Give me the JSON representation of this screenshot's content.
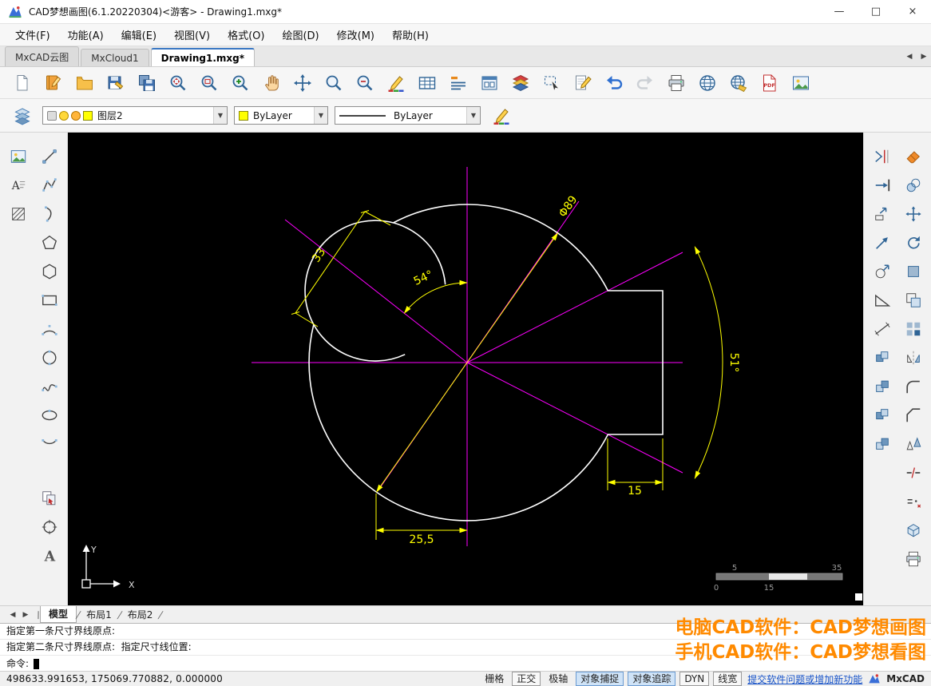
{
  "window": {
    "title": "CAD梦想画图(6.1.20220304)<游客> - Drawing1.mxg*",
    "controls": {
      "minimize": "—",
      "maximize": "□",
      "close": "×"
    }
  },
  "nav": {
    "prev": "◀",
    "next": "▶"
  },
  "menu": {
    "items": [
      {
        "id": "file",
        "label": "文件(F)"
      },
      {
        "id": "function",
        "label": "功能(A)"
      },
      {
        "id": "edit",
        "label": "编辑(E)"
      },
      {
        "id": "view",
        "label": "视图(V)"
      },
      {
        "id": "format",
        "label": "格式(O)"
      },
      {
        "id": "draw",
        "label": "绘图(D)"
      },
      {
        "id": "modify",
        "label": "修改(M)"
      },
      {
        "id": "help",
        "label": "帮助(H)"
      }
    ]
  },
  "doc_tabs": {
    "tabs": [
      {
        "id": "cloud",
        "label": "MxCAD云图",
        "active": false
      },
      {
        "id": "mxcloud1",
        "label": "MxCloud1",
        "active": false
      },
      {
        "id": "drawing1",
        "label": "Drawing1.mxg*",
        "active": true
      }
    ]
  },
  "toolbar": {
    "buttons": [
      {
        "name": "new-file",
        "icon": "page"
      },
      {
        "name": "open-cloud-drawing",
        "icon": "notebook"
      },
      {
        "name": "open-file",
        "icon": "folder"
      },
      {
        "name": "save-file",
        "icon": "floppy"
      },
      {
        "name": "save-all",
        "icon": "floppies"
      },
      {
        "name": "zoom-previous",
        "icon": "magArrows"
      },
      {
        "name": "zoom-window",
        "icon": "magWin"
      },
      {
        "name": "zoom-in",
        "icon": "magPlus"
      },
      {
        "name": "pan",
        "icon": "hand"
      },
      {
        "name": "zoom-extents",
        "icon": "arrowsCross"
      },
      {
        "name": "zoom-scale",
        "icon": "magPlain"
      },
      {
        "name": "zoom-out",
        "icon": "magMinus"
      },
      {
        "name": "draw-color",
        "icon": "pencilColor"
      },
      {
        "name": "insert-table",
        "icon": "table"
      },
      {
        "name": "text-style",
        "icon": "textLines"
      },
      {
        "name": "viewport",
        "icon": "window"
      },
      {
        "name": "layer-properties",
        "icon": "layersColor"
      },
      {
        "name": "select-objects",
        "icon": "selectBox"
      },
      {
        "name": "edit-text",
        "icon": "editPencil"
      },
      {
        "name": "undo",
        "icon": "undo"
      },
      {
        "name": "redo",
        "icon": "redo",
        "disabled": true
      },
      {
        "name": "print",
        "icon": "printer"
      },
      {
        "name": "web-open",
        "icon": "globe"
      },
      {
        "name": "web-upload",
        "icon": "globe2"
      },
      {
        "name": "export-pdf",
        "icon": "pdf"
      },
      {
        "name": "export-image",
        "icon": "image"
      }
    ]
  },
  "layer_bar": {
    "layer_combo": {
      "value": "图层2"
    },
    "color_combo": {
      "value": "ByLayer",
      "swatch": "#ffff00"
    },
    "linetype_combo": {
      "value": "ByLayer"
    },
    "arrow": "▼"
  },
  "left_tools": {
    "rows": [
      [
        {
          "name": "insert-raster-image",
          "icon": "image"
        },
        {
          "name": "draw-line",
          "icon": "line"
        }
      ],
      [
        {
          "name": "draw-text",
          "icon": "textA"
        },
        {
          "name": "draw-polyline",
          "icon": "polyline"
        }
      ],
      [
        {
          "name": "draw-hatch",
          "icon": "hatch"
        },
        {
          "name": "draw-curve",
          "icon": "curve"
        }
      ],
      [
        null,
        {
          "name": "draw-polygon",
          "icon": "pentagon"
        }
      ],
      [
        null,
        {
          "name": "draw-regular-polygon",
          "icon": "polygon"
        }
      ],
      [
        null,
        {
          "name": "draw-rectangle",
          "icon": "rect"
        }
      ],
      [
        null,
        {
          "name": "draw-arc",
          "icon": "arc"
        }
      ],
      [
        null,
        {
          "name": "draw-circle",
          "icon": "circle"
        }
      ],
      [
        null,
        {
          "name": "draw-spline",
          "icon": "spline"
        }
      ],
      [
        null,
        {
          "name": "draw-ellipse",
          "icon": "ellipse"
        }
      ],
      [
        null,
        {
          "name": "draw-arc-3point",
          "icon": "arc2"
        }
      ],
      "gap",
      [
        null,
        {
          "name": "copy-clip",
          "icon": "copysheet"
        }
      ],
      [
        null,
        {
          "name": "draw-donut",
          "icon": "donut"
        }
      ],
      [
        null,
        {
          "name": "draw-single-text",
          "icon": "bigA"
        }
      ]
    ]
  },
  "right_tools": {
    "rows": [
      [
        {
          "name": "trim",
          "icon": "trim"
        },
        {
          "name": "erase",
          "icon": "eraser"
        }
      ],
      [
        {
          "name": "extend",
          "icon": "extend"
        },
        {
          "name": "copy",
          "icon": "copy2circ"
        }
      ],
      [
        {
          "name": "stretch",
          "icon": "stretchArrow"
        },
        {
          "name": "move",
          "icon": "move"
        }
      ],
      [
        {
          "name": "lengthen",
          "icon": "lengthen"
        },
        {
          "name": "rotate",
          "icon": "rotate"
        }
      ],
      [
        {
          "name": "scale",
          "icon": "scale"
        },
        {
          "name": "region",
          "icon": "sq"
        }
      ],
      [
        {
          "name": "taper",
          "icon": "slope"
        },
        {
          "name": "offset",
          "icon": "offset"
        }
      ],
      [
        {
          "name": "measure",
          "icon": "measure"
        },
        {
          "name": "array",
          "icon": "array"
        }
      ],
      [
        {
          "name": "make-block",
          "icon": "blocks"
        },
        {
          "name": "mirror",
          "icon": "mirror"
        }
      ],
      [
        {
          "name": "insert-block",
          "icon": "blocks2"
        },
        {
          "name": "fillet",
          "icon": "fillet"
        }
      ],
      [
        {
          "name": "edit-block",
          "icon": "blocks"
        },
        {
          "name": "chamfer",
          "icon": "chamfer"
        }
      ],
      [
        {
          "name": "group",
          "icon": "blocks2"
        },
        {
          "name": "align",
          "icon": "align"
        }
      ],
      [
        null,
        {
          "name": "break",
          "icon": "break"
        }
      ],
      [
        null,
        {
          "name": "divide",
          "icon": "divide"
        }
      ],
      [
        null,
        {
          "name": "model-3d",
          "icon": "box3d"
        }
      ],
      [
        null,
        {
          "name": "plot",
          "icon": "printer"
        }
      ]
    ]
  },
  "drawing": {
    "dimensions": {
      "diameter": "Φ89",
      "length_33": "33",
      "angle_54": "54°",
      "angle_51": "51°",
      "length_25_5": "25,5",
      "length_15": "15"
    },
    "scale_bar": {
      "top_left": "5",
      "top_right": "35",
      "bottom_left": "0",
      "bottom_mid": "15"
    },
    "ucs": {
      "x_label": "X",
      "y_label": "Y"
    },
    "colors": {
      "background": "#000000",
      "geometry": "#ffffff",
      "construction": "#ff00ff",
      "dimension": "#ffff00"
    }
  },
  "layout_tabs": {
    "lead": "\\",
    "separator": "/",
    "tabs": [
      {
        "id": "model",
        "label": "模型",
        "active": true
      },
      {
        "id": "layout1",
        "label": "布局1",
        "active": false
      },
      {
        "id": "layout2",
        "label": "布局2",
        "active": false
      }
    ]
  },
  "command": {
    "lines": [
      "指定第一条尺寸界线原点:",
      "指定第二条尺寸界线原点:  指定尺寸线位置:"
    ],
    "prompt": "命令:"
  },
  "promo": {
    "line1": "电脑CAD软件：CAD梦想画图",
    "line2": "手机CAD软件：CAD梦想看图",
    "color": "#ff8a00"
  },
  "status_bar": {
    "coordinates": "498633.991653,  175069.770882,  0.000000",
    "toggles": [
      {
        "id": "grid",
        "label": "栅格",
        "state": "plain"
      },
      {
        "id": "ortho",
        "label": "正交",
        "state": "boxed"
      },
      {
        "id": "polar",
        "label": "极轴",
        "state": "plain"
      },
      {
        "id": "osnap",
        "label": "对象捕捉",
        "state": "active"
      },
      {
        "id": "otrack",
        "label": "对象追踪",
        "state": "active"
      },
      {
        "id": "dyn",
        "label": "DYN",
        "state": "boxed"
      },
      {
        "id": "lineweight",
        "label": "线宽",
        "state": "boxed"
      }
    ],
    "feedback_link": "提交软件问题或增加新功能",
    "brand": "MxCAD"
  }
}
